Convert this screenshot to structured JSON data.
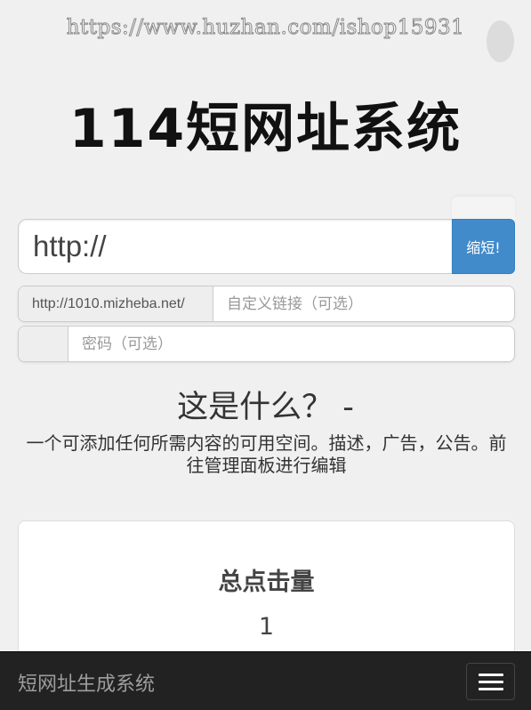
{
  "watermark": "https://www.huzhan.com/ishop15931",
  "logo": "114短网址系统",
  "url_form": {
    "url_value": "http://",
    "shorten_label": "缩短!"
  },
  "custom_link": {
    "domain_prefix": "http://1010.mizheba.net/",
    "placeholder": "自定义链接（可选）"
  },
  "password": {
    "placeholder": "密码（可选）"
  },
  "info": {
    "heading": "这是什么？ -",
    "description": "一个可添加任何所需内容的可用空间。描述，广告，公告。前往管理面板进行编辑"
  },
  "stats": {
    "title": "总点击量",
    "value": "1"
  },
  "navbar": {
    "brand": "短网址生成系统"
  }
}
